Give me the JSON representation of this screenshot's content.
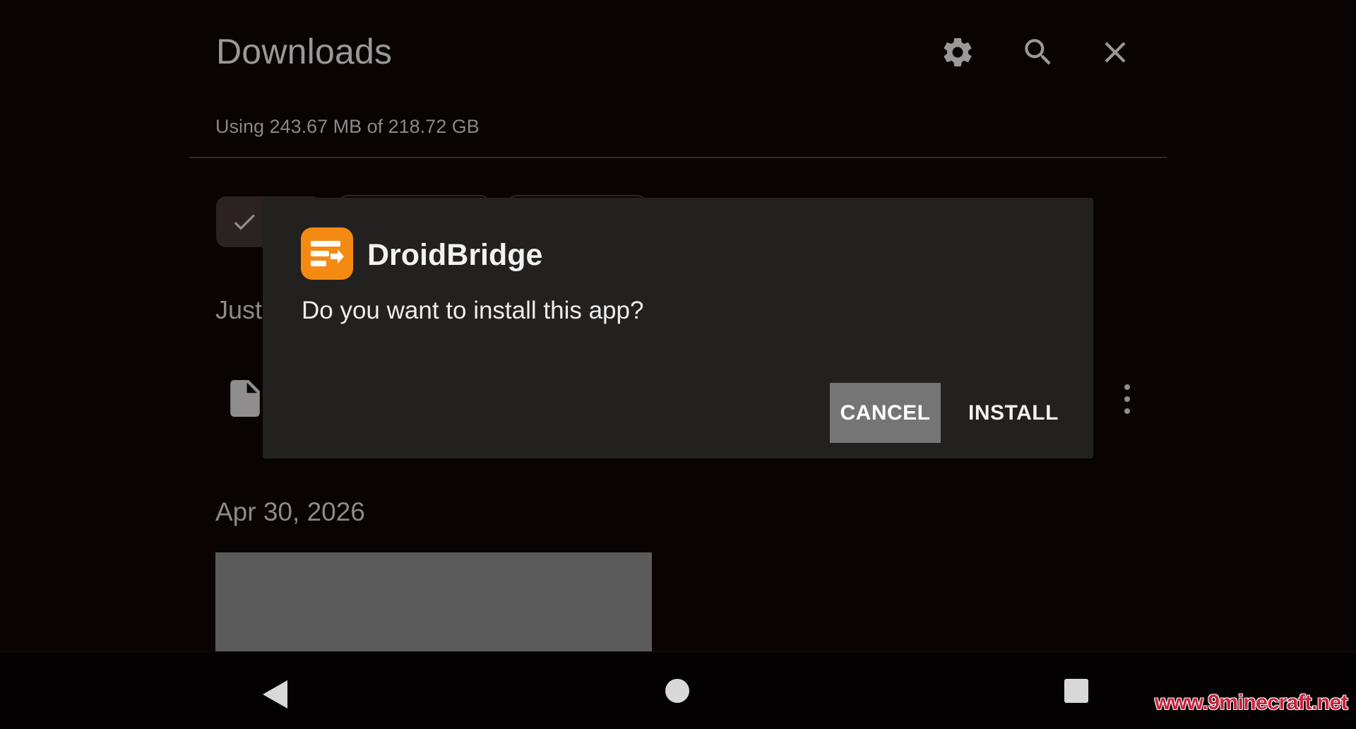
{
  "header": {
    "title": "Downloads",
    "storage_text": "Using 243.67 MB of 218.72 GB",
    "icons": [
      "gear-icon",
      "search-icon",
      "close-icon"
    ]
  },
  "sections": {
    "recent_label": "Just",
    "date_label": "Apr 30, 2026"
  },
  "dialog": {
    "app_name": "DroidBridge",
    "question": "Do you want to install this app?",
    "cancel_label": "CANCEL",
    "install_label": "INSTALL",
    "app_icon_color": "#f58a12"
  },
  "navbar": {
    "icons": [
      "back-icon",
      "home-icon",
      "recents-icon"
    ]
  },
  "watermark": "www.9minecraft.net"
}
